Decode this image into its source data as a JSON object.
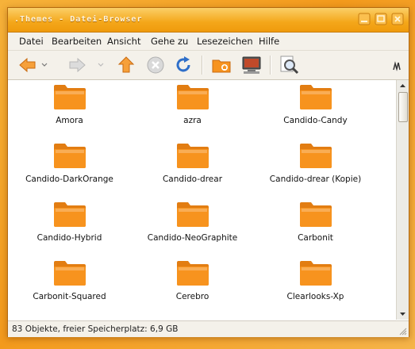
{
  "window": {
    "title": ".Themes - Datei-Browser"
  },
  "menu": {
    "items": [
      {
        "label": "Datei"
      },
      {
        "label": "Bearbeiten"
      },
      {
        "label": "Ansicht"
      },
      {
        "label": "Gehe zu"
      },
      {
        "label": "Lesezeichen"
      },
      {
        "label": "Hilfe"
      }
    ]
  },
  "toolbar": {
    "buttons": [
      "back-icon",
      "forward-icon",
      "up-icon",
      "stop-icon",
      "reload-icon",
      "home-folder-icon",
      "computer-icon",
      "zoom-icon"
    ]
  },
  "files": [
    {
      "name": "Amora"
    },
    {
      "name": "azra"
    },
    {
      "name": "Candido-Candy"
    },
    {
      "name": "Candido-DarkOrange"
    },
    {
      "name": "Candido-drear"
    },
    {
      "name": "Candido-drear (Kopie)"
    },
    {
      "name": "Candido-Hybrid"
    },
    {
      "name": "Candido-NeoGraphite"
    },
    {
      "name": "Carbonit"
    },
    {
      "name": "Carbonit-Squared"
    },
    {
      "name": "Cerebro"
    },
    {
      "name": "Clearlooks-Xp"
    }
  ],
  "status": {
    "text": "83 Objekte, freier Speicherplatz: 6,9 GB"
  },
  "colors": {
    "accent": "#f39a1c",
    "folder": "#f7931e"
  }
}
